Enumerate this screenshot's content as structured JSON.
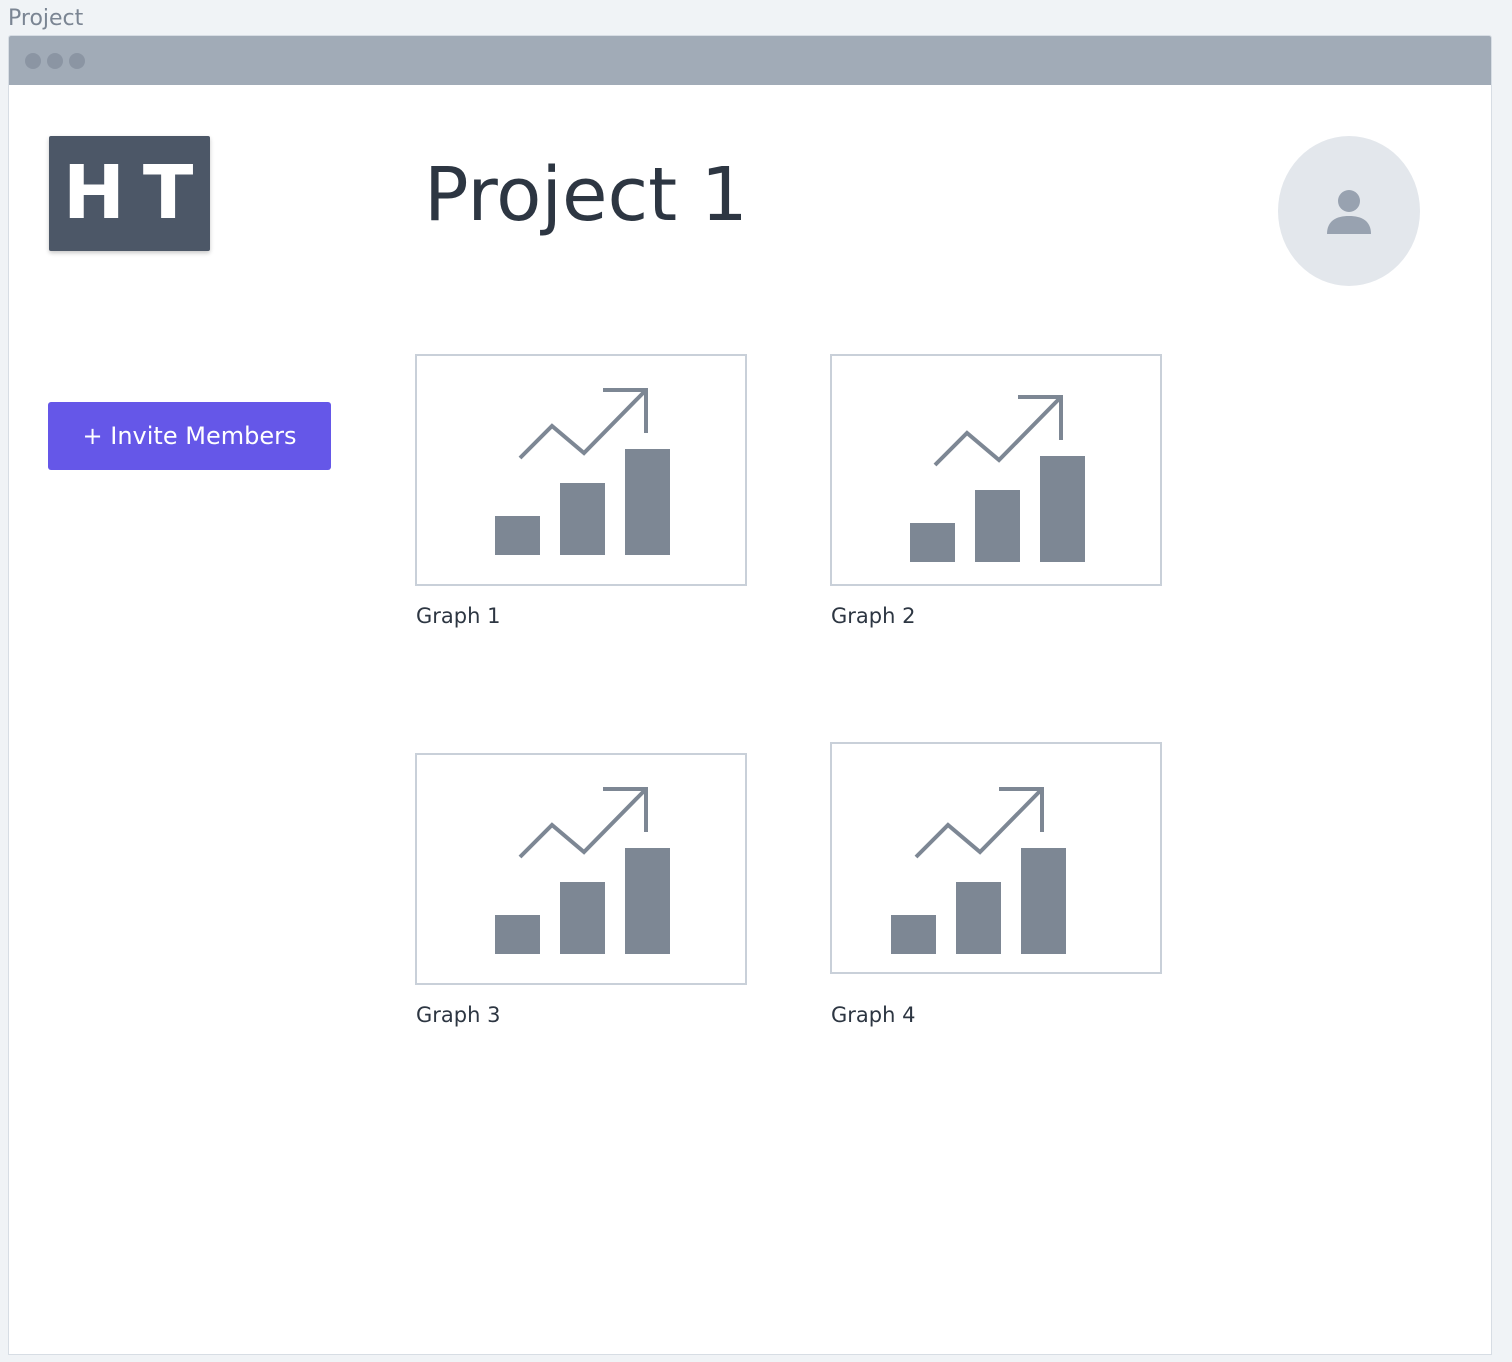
{
  "frame": {
    "label": "Project"
  },
  "header": {
    "logo_text": "HT",
    "title": "Project 1"
  },
  "sidebar": {
    "invite_button_label": "+ Invite Members"
  },
  "graphs": [
    {
      "label": "Graph 1",
      "icon": "chart-icon"
    },
    {
      "label": "Graph 2",
      "icon": "chart-icon"
    },
    {
      "label": "Graph 3",
      "icon": "chart-icon"
    },
    {
      "label": "Graph 4",
      "icon": "chart-icon"
    }
  ],
  "colors": {
    "accent": "#6557e8",
    "logo_bg": "#4c5767",
    "titlebar": "#a1abb7",
    "icon": "#7d8794"
  }
}
